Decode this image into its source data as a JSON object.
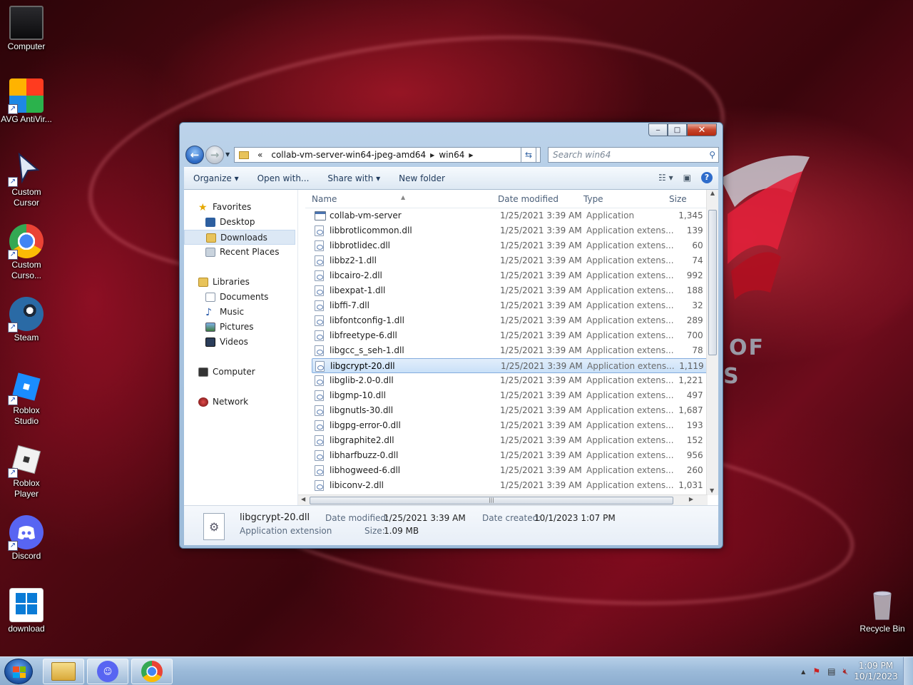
{
  "desktop": {
    "icons": [
      {
        "label": "Computer",
        "icon": "computer-icon"
      },
      {
        "label": "AVG AntiVir...",
        "icon": "avg-antivirus-icon"
      },
      {
        "label": "Custom Cursor",
        "icon": "custom-cursor-icon"
      },
      {
        "label": "Custom Curso...",
        "icon": "chrome-icon"
      },
      {
        "label": "Steam",
        "icon": "steam-icon"
      },
      {
        "label": "Roblox Studio",
        "icon": "roblox-studio-icon"
      },
      {
        "label": "Roblox Player",
        "icon": "roblox-player-icon"
      },
      {
        "label": "Discord",
        "icon": "discord-icon"
      },
      {
        "label": "download",
        "icon": "windows11-image-icon"
      },
      {
        "label": "Recycle Bin",
        "icon": "recycle-bin-icon"
      }
    ],
    "wallpaper_text": [
      "OF",
      "S"
    ]
  },
  "explorer": {
    "titlebar": {
      "minimize": "‒",
      "maximize": "□",
      "close": "✕"
    },
    "address": {
      "prefix": "«",
      "segments": [
        "collab-vm-server-win64-jpeg-amd64",
        "win64"
      ]
    },
    "search": {
      "placeholder": "Search win64"
    },
    "toolbar": {
      "organize": "Organize ▾",
      "open_with": "Open with...",
      "share_with": "Share with ▾",
      "new_folder": "New folder"
    },
    "nav": {
      "favorites": "Favorites",
      "desktop": "Desktop",
      "downloads": "Downloads",
      "recent": "Recent Places",
      "libraries": "Libraries",
      "documents": "Documents",
      "music": "Music",
      "pictures": "Pictures",
      "videos": "Videos",
      "computer": "Computer",
      "network": "Network"
    },
    "columns": {
      "name": "Name",
      "date": "Date modified",
      "type": "Type",
      "size": "Size"
    },
    "files": [
      {
        "name": "collab-vm-server",
        "date": "1/25/2021 3:39 AM",
        "type": "Application",
        "size": "1,345 I",
        "kind": "exe"
      },
      {
        "name": "libbrotlicommon.dll",
        "date": "1/25/2021 3:39 AM",
        "type": "Application extens...",
        "size": "139 I",
        "kind": "dll"
      },
      {
        "name": "libbrotlidec.dll",
        "date": "1/25/2021 3:39 AM",
        "type": "Application extens...",
        "size": "60 I",
        "kind": "dll"
      },
      {
        "name": "libbz2-1.dll",
        "date": "1/25/2021 3:39 AM",
        "type": "Application extens...",
        "size": "74 I",
        "kind": "dll"
      },
      {
        "name": "libcairo-2.dll",
        "date": "1/25/2021 3:39 AM",
        "type": "Application extens...",
        "size": "992 I",
        "kind": "dll"
      },
      {
        "name": "libexpat-1.dll",
        "date": "1/25/2021 3:39 AM",
        "type": "Application extens...",
        "size": "188 I",
        "kind": "dll"
      },
      {
        "name": "libffi-7.dll",
        "date": "1/25/2021 3:39 AM",
        "type": "Application extens...",
        "size": "32 I",
        "kind": "dll"
      },
      {
        "name": "libfontconfig-1.dll",
        "date": "1/25/2021 3:39 AM",
        "type": "Application extens...",
        "size": "289 I",
        "kind": "dll"
      },
      {
        "name": "libfreetype-6.dll",
        "date": "1/25/2021 3:39 AM",
        "type": "Application extens...",
        "size": "700 I",
        "kind": "dll"
      },
      {
        "name": "libgcc_s_seh-1.dll",
        "date": "1/25/2021 3:39 AM",
        "type": "Application extens...",
        "size": "78 I",
        "kind": "dll"
      },
      {
        "name": "libgcrypt-20.dll",
        "date": "1/25/2021 3:39 AM",
        "type": "Application extens...",
        "size": "1,119 I",
        "kind": "dll",
        "selected": true
      },
      {
        "name": "libglib-2.0-0.dll",
        "date": "1/25/2021 3:39 AM",
        "type": "Application extens...",
        "size": "1,221 I",
        "kind": "dll"
      },
      {
        "name": "libgmp-10.dll",
        "date": "1/25/2021 3:39 AM",
        "type": "Application extens...",
        "size": "497 I",
        "kind": "dll"
      },
      {
        "name": "libgnutls-30.dll",
        "date": "1/25/2021 3:39 AM",
        "type": "Application extens...",
        "size": "1,687 I",
        "kind": "dll"
      },
      {
        "name": "libgpg-error-0.dll",
        "date": "1/25/2021 3:39 AM",
        "type": "Application extens...",
        "size": "193 I",
        "kind": "dll"
      },
      {
        "name": "libgraphite2.dll",
        "date": "1/25/2021 3:39 AM",
        "type": "Application extens...",
        "size": "152 I",
        "kind": "dll"
      },
      {
        "name": "libharfbuzz-0.dll",
        "date": "1/25/2021 3:39 AM",
        "type": "Application extens...",
        "size": "956 I",
        "kind": "dll"
      },
      {
        "name": "libhogweed-6.dll",
        "date": "1/25/2021 3:39 AM",
        "type": "Application extens...",
        "size": "260 I",
        "kind": "dll"
      },
      {
        "name": "libiconv-2.dll",
        "date": "1/25/2021 3:39 AM",
        "type": "Application extens...",
        "size": "1,031 I",
        "kind": "dll"
      }
    ],
    "details": {
      "filename": "libgcrypt-20.dll",
      "filetype": "Application extension",
      "date_modified_label": "Date modified:",
      "date_modified": "1/25/2021 3:39 AM",
      "size_label": "Size:",
      "size": "1.09 MB",
      "date_created_label": "Date created:",
      "date_created": "10/1/2023 1:07 PM"
    }
  },
  "taskbar": {
    "buttons": [
      "start-button",
      "explorer-taskbar-button",
      "discord-taskbar-button",
      "chrome-taskbar-button"
    ],
    "clock": {
      "time": "1:09 PM",
      "date": "10/1/2023"
    },
    "tray": {
      "show_hidden": "▲"
    }
  },
  "colors": {
    "selection": "#cde3f9",
    "accent": "#2a67c2",
    "wallpaper": "#5a0a14"
  }
}
